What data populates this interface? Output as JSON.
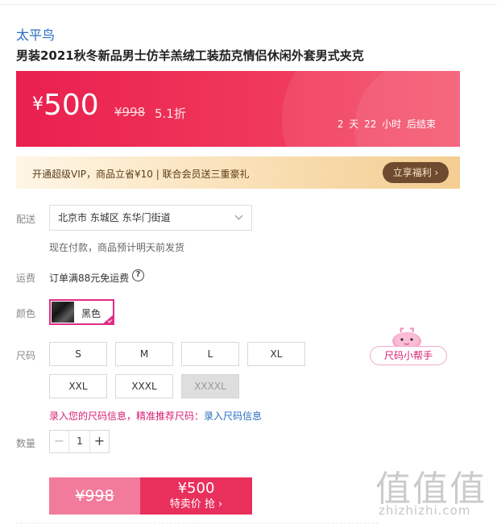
{
  "product": {
    "brand": "太平鸟",
    "title": "男装2021秋冬新品男士仿羊羔绒工装茄克情侣休闲外套男式夹克"
  },
  "price": {
    "currency": "¥",
    "current": "500",
    "original": "¥998",
    "discount": "5.1折",
    "countdown": "2 天 22 小时 后结束"
  },
  "vip": {
    "text": "开通超级VIP，商品立省¥10 | 联合会员送三重豪礼",
    "button_label": "立享福利 ›"
  },
  "delivery": {
    "label": "配送",
    "address": "北京市 东城区 东华门街道",
    "note": "现在付款，商品预计明天前发货"
  },
  "freight": {
    "label": "运费",
    "text": "订单满88元免运费",
    "help": "?"
  },
  "color": {
    "label": "颜色",
    "options": [
      {
        "label": "黑色",
        "selected": true
      }
    ]
  },
  "size": {
    "label": "尺码",
    "options": [
      {
        "label": "S",
        "available": true
      },
      {
        "label": "M",
        "available": true
      },
      {
        "label": "L",
        "available": true
      },
      {
        "label": "XL",
        "available": true
      },
      {
        "label": "XXL",
        "available": true
      },
      {
        "label": "XXXL",
        "available": true
      },
      {
        "label": "XXXXL",
        "available": false
      }
    ],
    "tip_text": "录入您的尺码信息，精准推荐尺码：",
    "tip_link": "录入尺码信息",
    "helper_label": "尺码小帮手"
  },
  "quantity": {
    "label": "数量",
    "value": "1",
    "minus": "−",
    "plus": "+"
  },
  "buy": {
    "original_price": "¥998",
    "special_price": "¥500",
    "action_label": "特卖价 抢 ›"
  },
  "watermark": {
    "logo": "值值值",
    "url": "zhizhizhi.com"
  },
  "colors": {
    "accent": "#e9305d",
    "pink": "#d81e74",
    "link": "#2a6dc2"
  }
}
